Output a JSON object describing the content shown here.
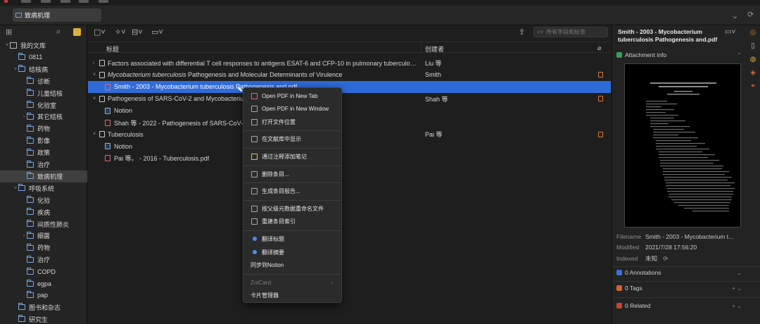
{
  "tab": {
    "label": "致病机理"
  },
  "search": {
    "placeholder": "所有字段和标签"
  },
  "columns": {
    "title": "标题",
    "creator": "创建者"
  },
  "tree": [
    {
      "label": "我的文库",
      "level": 0,
      "twisty": "˅",
      "type": "library"
    },
    {
      "label": "0811",
      "level": 1,
      "twisty": ""
    },
    {
      "label": "结核病",
      "level": 1,
      "twisty": "˅"
    },
    {
      "label": "诊断",
      "level": 2,
      "twisty": ""
    },
    {
      "label": "儿童结核",
      "level": 2,
      "twisty": ""
    },
    {
      "label": "化验室",
      "level": 2,
      "twisty": ""
    },
    {
      "label": "其它结核",
      "level": 2,
      "twisty": "›"
    },
    {
      "label": "药物",
      "level": 2,
      "twisty": ""
    },
    {
      "label": "影像",
      "level": 2,
      "twisty": ""
    },
    {
      "label": "政策",
      "level": 2,
      "twisty": ""
    },
    {
      "label": "治疗",
      "level": 2,
      "twisty": ""
    },
    {
      "label": "致病机理",
      "level": 2,
      "twisty": "",
      "selected": true
    },
    {
      "label": "呼吸系统",
      "level": 1,
      "twisty": "˅"
    },
    {
      "label": "化验",
      "level": 2,
      "twisty": ""
    },
    {
      "label": "疾病",
      "level": 2,
      "twisty": ""
    },
    {
      "label": "间质性肺炎",
      "level": 2,
      "twisty": ""
    },
    {
      "label": "细菌",
      "level": 2,
      "twisty": "›"
    },
    {
      "label": "药物",
      "level": 2,
      "twisty": ""
    },
    {
      "label": "治疗",
      "level": 2,
      "twisty": ""
    },
    {
      "label": "COPD",
      "level": 2,
      "twisty": ""
    },
    {
      "label": "egpa",
      "level": 2,
      "twisty": ""
    },
    {
      "label": "pap",
      "level": 2,
      "twisty": ""
    },
    {
      "label": "图书和杂志",
      "level": 1,
      "twisty": ""
    },
    {
      "label": "研究生",
      "level": 1,
      "twisty": ""
    }
  ],
  "items": [
    {
      "title": "Factors associated with differential T cell responses to antigens ESAT-6 and CFP-10 in pulmonary tuberculosis p...",
      "creator": "Liu 等",
      "level": 0,
      "twisty": "›",
      "icon": "doc",
      "attachment": false
    },
    {
      "title_italic": "Mycobacterium tuberculosis",
      "title": " Pathogenesis and Molecular Determinants of Virulence",
      "creator": "Smith",
      "level": 0,
      "twisty": "˅",
      "icon": "doc",
      "attachment": true
    },
    {
      "title": "Smith - 2003 - Mycobacterium tuberculosis Pathogenesis and.pdf",
      "creator": "",
      "level": 1,
      "twisty": "",
      "icon": "pdf",
      "selected": true,
      "attachment": false
    },
    {
      "title": "Pathogenesis of SARS-CoV-2 and Mycobacterium",
      "creator": "Shah 等",
      "level": 0,
      "twisty": "˅",
      "icon": "doc",
      "attachment": true
    },
    {
      "title": "Notion",
      "creator": "",
      "level": 1,
      "twisty": "",
      "icon": "note",
      "attachment": false
    },
    {
      "title": "Shah 等 - 2022 - Pathogenesis of SARS-CoV-2 a",
      "creator": "",
      "level": 1,
      "twisty": "",
      "icon": "pdf",
      "attachment": false
    },
    {
      "title": "Tuberculosis",
      "creator": "Pai 等",
      "level": 0,
      "twisty": "˅",
      "icon": "doc",
      "attachment": true
    },
    {
      "title": "Notion",
      "creator": "",
      "level": 1,
      "twisty": "",
      "icon": "note",
      "attachment": false
    },
    {
      "title": "Pai 等。 - 2016 - Tuberculosis.pdf",
      "creator": "",
      "level": 1,
      "twisty": "",
      "icon": "pdf",
      "attachment": false
    }
  ],
  "menu": [
    {
      "label": "Open PDF in New Tab",
      "icon": "pdf"
    },
    {
      "label": "Open PDF in New Window",
      "icon": "doc"
    },
    {
      "label": "打开文件位置",
      "icon": "doc"
    },
    {
      "sep": true
    },
    {
      "label": "在文献库中显示",
      "icon": "doc"
    },
    {
      "sep": true
    },
    {
      "label": "通过注释添加笔记",
      "icon": "pen"
    },
    {
      "sep": true
    },
    {
      "label": "删除条目...",
      "icon": "doc"
    },
    {
      "sep": true
    },
    {
      "label": "生成条目报告...",
      "icon": "doc"
    },
    {
      "sep": true
    },
    {
      "label": "按父级元数据重命名文件",
      "icon": "doc"
    },
    {
      "label": "重建条目索引",
      "icon": "doc"
    },
    {
      "sep": true
    },
    {
      "label": "翻译标题",
      "icon": "blue"
    },
    {
      "label": "翻译摘要",
      "icon": "blue"
    },
    {
      "label": "同步到Notion",
      "icon": "none"
    },
    {
      "sep": true
    },
    {
      "label": "ZotCard",
      "icon": "none",
      "disabled": true,
      "submenu": true
    },
    {
      "label": "卡片管理器",
      "icon": "none"
    }
  ],
  "right": {
    "title": "Smith - 2003 - Mycobacterium tuberculosis Pathogenesis and.pdf",
    "attachment_info": "Attachment info",
    "filename_label": "Filename",
    "filename": "Smith - 2003 - Mycobacterium t...",
    "modified_label": "Modified",
    "modified": "2021/7/28 17:56:20",
    "indexed_label": "Indexed",
    "indexed": "未知",
    "annotations": "0 Annotations",
    "tags": "0 Tags",
    "related": "0 Related"
  },
  "colors": {
    "selection": "#2f6bd8",
    "folder": "#7ba7e0"
  }
}
